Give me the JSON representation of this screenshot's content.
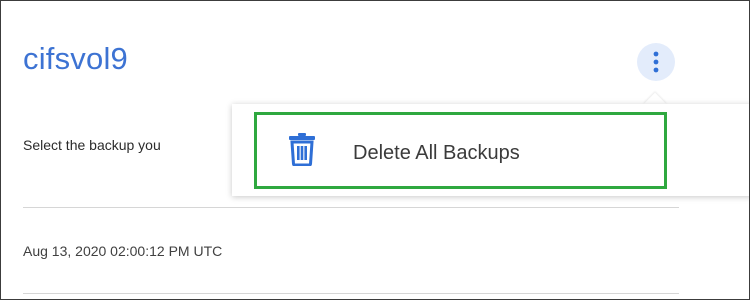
{
  "volume": {
    "name": "cifsvol9",
    "more_icon": "vertical-ellipsis-icon"
  },
  "panel": {
    "instruction": "Select the backup you",
    "backups": [
      {
        "timestamp": "Aug 13, 2020 02:00:12 PM UTC"
      }
    ]
  },
  "menu": {
    "items": [
      {
        "label": "Delete All Backups",
        "icon": "trash-icon"
      }
    ]
  },
  "colors": {
    "title": "#3d73d3",
    "highlight_border": "#2fa83f",
    "icon_blue": "#2f6fd6",
    "more_button_bg": "#e3ecfb"
  }
}
